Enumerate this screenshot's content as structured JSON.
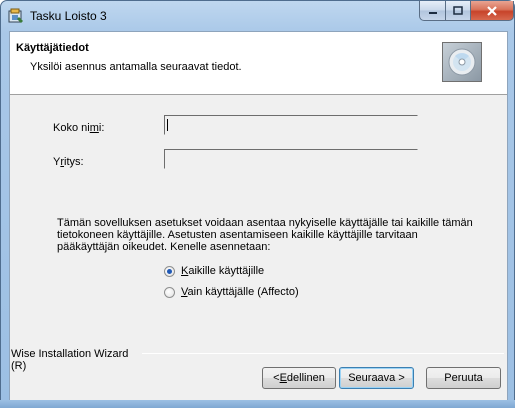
{
  "window": {
    "title": "Tasku Loisto 3"
  },
  "header": {
    "title": "Käyttäjätiedot",
    "subtitle": "Yksilöi asennus antamalla seuraavat tiedot."
  },
  "form": {
    "name_label_pre": "Koko ni",
    "name_label_key": "m",
    "name_label_post": "i:",
    "name_value": "",
    "company_label_pre": "Y",
    "company_label_key": "r",
    "company_label_post": "itys:",
    "company_value": ""
  },
  "info_text": "Tämän sovelluksen asetukset voidaan asentaa nykyiselle käyttäjälle tai kaikille tämän tietokoneen käyttäjille. Asetusten asentamiseen kaikille käyttäjille tarvitaan pääkäyttäjän oikeudet. Kenelle asennetaan:",
  "options": {
    "all_users_key": "K",
    "all_users_rest": "aikille käyttäjille",
    "only_user_key": "V",
    "only_user_rest": "ain käyttäjälle (Affecto)",
    "selected": "all_users"
  },
  "footer": {
    "wizard_label": "Wise Installation Wizard",
    "wizard_suffix": "(R)"
  },
  "buttons": {
    "back_prefix": "< ",
    "back_key": "E",
    "back_rest": "dellinen",
    "next_label": "Seuraava >",
    "cancel_label": "Peruuta"
  }
}
